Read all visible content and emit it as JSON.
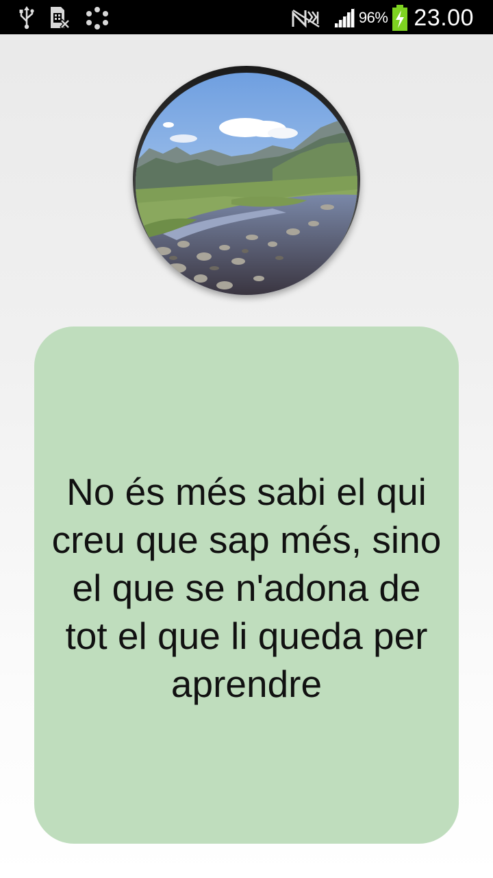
{
  "status_bar": {
    "battery_percent": "96%",
    "time": "23.00",
    "icons": {
      "usb": "usb-icon",
      "sim": "no-sim-icon",
      "apps": "dots-icon",
      "nfc": "no-signal-icon",
      "signal": "signal-icon",
      "battery": "battery-charging-icon"
    },
    "battery_color": "#7ed321"
  },
  "photo": {
    "subject": "mountain-lake-landscape"
  },
  "quote": {
    "text": "No és més sabi el qui creu que sap més, sino el que se n'adona de tot el que li queda per aprendre",
    "card_color": "#bfddbd"
  }
}
